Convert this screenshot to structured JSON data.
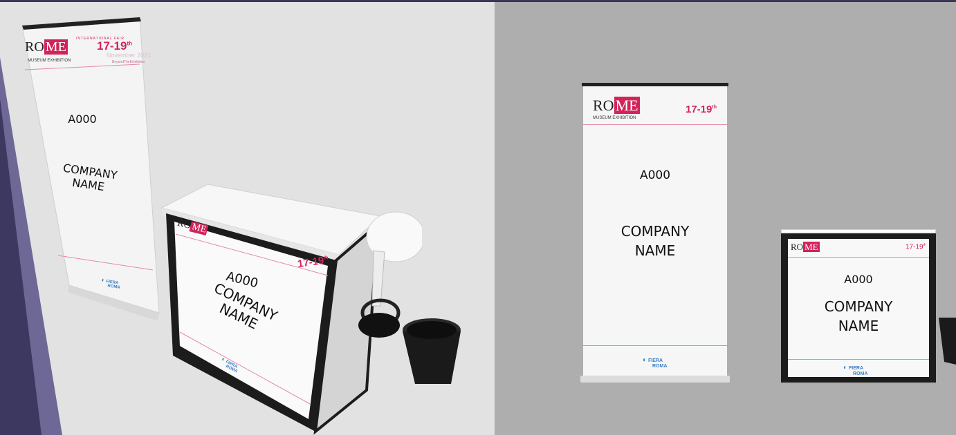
{
  "brand": {
    "rome_ro": "RO",
    "rome_me": "ME",
    "subtitle": "MUSEUM EXHIBITION",
    "fair_label": "INTERNATIONAL FAIR",
    "dates": "17-19",
    "dates_sup": "th",
    "month_year": "November 2021",
    "tagline": "BeyondTheExhibition",
    "fiera_line1": "FIERA",
    "fiera_line2": "ROMA"
  },
  "booth": {
    "stand_number": "A000",
    "company_line1": "COMPANY",
    "company_line2": "NAME"
  },
  "colors": {
    "accent": "#d2245a",
    "left_bg": "#e2e2e2",
    "right_bg": "#aeaeae",
    "frame": "#1a1a1a",
    "fiera_blue": "#3a7fc4"
  }
}
